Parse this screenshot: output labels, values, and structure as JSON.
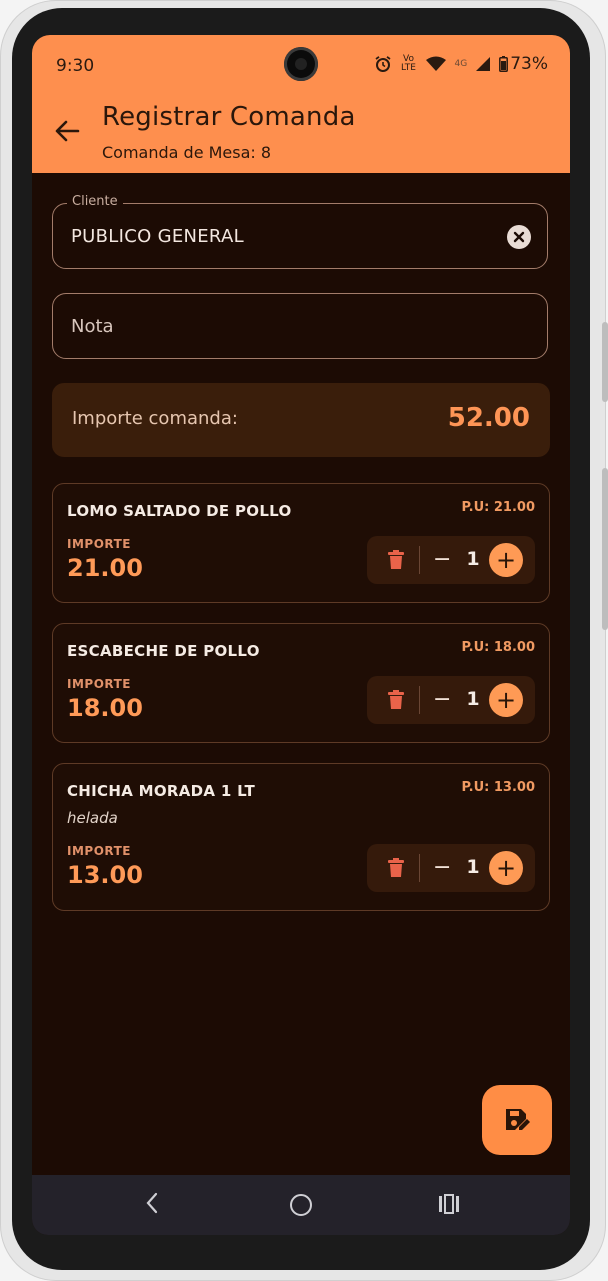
{
  "status_bar": {
    "time": "9:30",
    "network_label": "Vo LTE",
    "network_4g": "4G",
    "battery": "73%"
  },
  "header": {
    "title": "Registrar Comanda",
    "subtitle": "Comanda de Mesa: 8",
    "back_icon": "arrow-back-icon"
  },
  "form": {
    "client_label": "Cliente",
    "client_value": "PUBLICO GENERAL",
    "note_placeholder": "Nota"
  },
  "summary": {
    "label": "Importe comanda:",
    "total": "52.00"
  },
  "items": [
    {
      "name": "LOMO SALTADO DE POLLO",
      "pu": "P.U: 21.00",
      "note": "",
      "importe_label": "IMPORTE",
      "importe": "21.00",
      "qty": "1"
    },
    {
      "name": "ESCABECHE DE POLLO",
      "pu": "P.U: 18.00",
      "note": "",
      "importe_label": "IMPORTE",
      "importe": "18.00",
      "qty": "1"
    },
    {
      "name": "CHICHA MORADA 1 LT",
      "pu": "P.U: 13.00",
      "note": "helada",
      "importe_label": "IMPORTE",
      "importe": "13.00",
      "qty": "1"
    }
  ],
  "controls": {
    "minus_glyph": "−",
    "plus_glyph": "+"
  },
  "colors": {
    "accent": "#fe8f4e",
    "background": "#1c0b04",
    "price": "#ff9a58",
    "trash": "#e9634a"
  },
  "fab": {
    "icon": "save-edit-icon"
  }
}
